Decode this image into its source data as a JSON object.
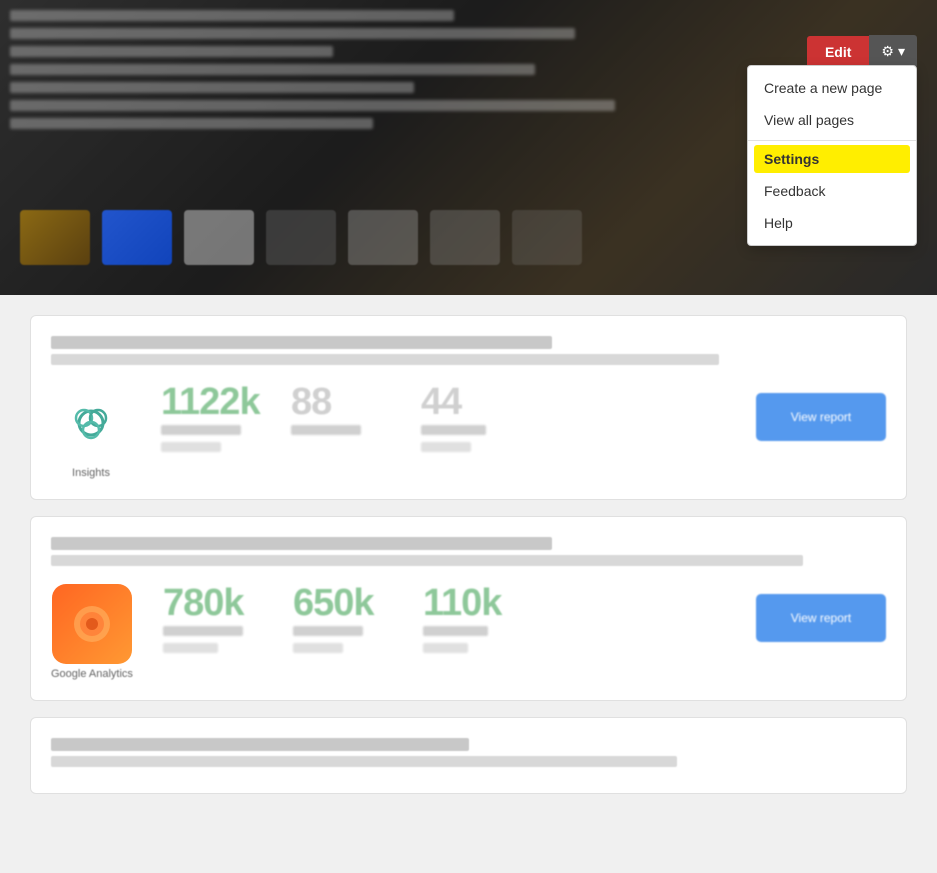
{
  "hero": {
    "background_description": "blurred dark hero image with content"
  },
  "toolbar": {
    "edit_label": "Edit",
    "gear_icon": "⚙",
    "chevron_icon": "▾"
  },
  "dropdown": {
    "items": [
      {
        "id": "create-new-page",
        "label": "Create a new page",
        "highlighted": false
      },
      {
        "id": "view-all-pages",
        "label": "View all pages",
        "highlighted": false
      },
      {
        "id": "settings",
        "label": "Settings",
        "highlighted": true
      },
      {
        "id": "feedback",
        "label": "Feedback",
        "highlighted": false
      },
      {
        "id": "help",
        "label": "Help",
        "highlighted": false
      }
    ]
  },
  "widgets": [
    {
      "id": "insights",
      "logo_color": "green",
      "logo_emoji": "🌿",
      "logo_label": "Insights",
      "title_line": "",
      "subtitle_line": "",
      "stats": [
        {
          "value": "1122k",
          "label": "Visitors",
          "sublabel": "Indexed"
        },
        {
          "value": "88",
          "label": "Actions",
          "sublabel": ""
        },
        {
          "value": "44",
          "label": "Goals",
          "sublabel": "Subgoals"
        }
      ],
      "action_label": "View report"
    },
    {
      "id": "google-analytics",
      "logo_color": "orange",
      "logo_emoji": "📊",
      "logo_label": "Google Analytics",
      "title_line": "",
      "subtitle_line": "",
      "stats": [
        {
          "value": "780k",
          "label": "Sessions",
          "sublabel": ""
        },
        {
          "value": "650k",
          "label": "Users",
          "sublabel": ""
        },
        {
          "value": "110k",
          "label": "Goals",
          "sublabel": ""
        }
      ],
      "action_label": "View report"
    }
  ],
  "third_widget": {
    "title_line": "",
    "subtitle_line": ""
  }
}
